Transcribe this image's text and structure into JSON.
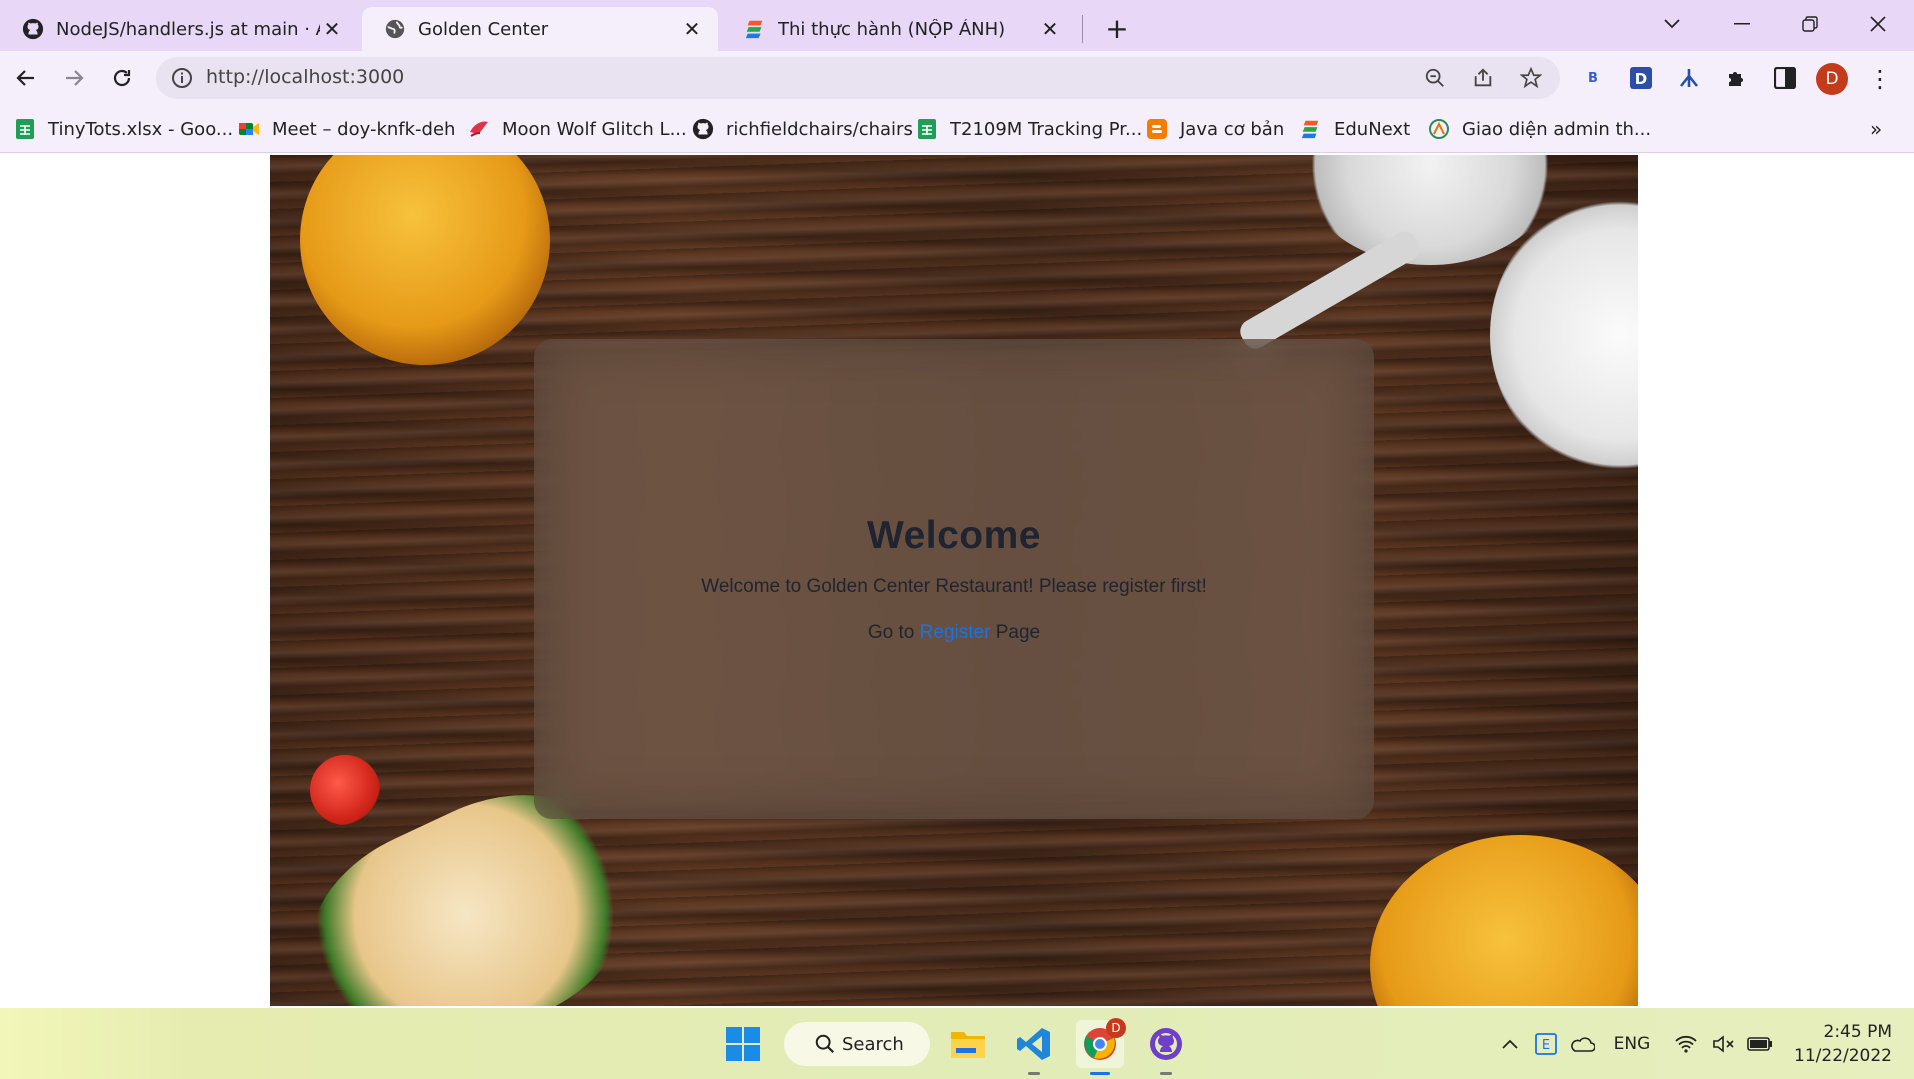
{
  "browser": {
    "tabs": [
      {
        "title": "NodeJS/handlers.js at main · AnhTu",
        "icon": "github-icon",
        "active": false
      },
      {
        "title": "Golden Center",
        "icon": "globe-icon",
        "active": true
      },
      {
        "title": "Thi thực hành (NỘP ẢNH)",
        "icon": "edunext-icon",
        "active": false
      }
    ],
    "new_tab_label": "+",
    "url": "http://localhost:3000",
    "profile_initial": "D",
    "bookmarks": [
      {
        "label": "TinyTots.xlsx - Goo...",
        "icon": "sheets-icon"
      },
      {
        "label": "Meet – doy-knfk-deh",
        "icon": "meet-icon"
      },
      {
        "label": "Moon Wolf Glitch L...",
        "icon": "glitch-icon"
      },
      {
        "label": "richfieldchairs/chairs",
        "icon": "github-icon"
      },
      {
        "label": "T2109M Tracking Pr...",
        "icon": "sheets-icon"
      },
      {
        "label": "Java cơ bản",
        "icon": "blogger-icon"
      },
      {
        "label": "EduNext",
        "icon": "edunext-icon"
      },
      {
        "label": "Giao diện admin th...",
        "icon": "admin-icon"
      }
    ],
    "more_bookmarks": "»"
  },
  "page": {
    "title": "Welcome",
    "subtitle": "Welcome to Golden Center Restaurant! Please register first!",
    "goto_prefix": "Go to",
    "register_link": "Register",
    "goto_suffix": "Page"
  },
  "taskbar": {
    "search_label": "Search",
    "chrome_badge": "D",
    "language": "ENG",
    "time": "2:45 PM",
    "date": "11/22/2022"
  },
  "colors": {
    "tabstrip": "#e8d7f7",
    "toolbar": "#f5effc",
    "link": "#1a73e8",
    "heading": "#1f2430"
  }
}
